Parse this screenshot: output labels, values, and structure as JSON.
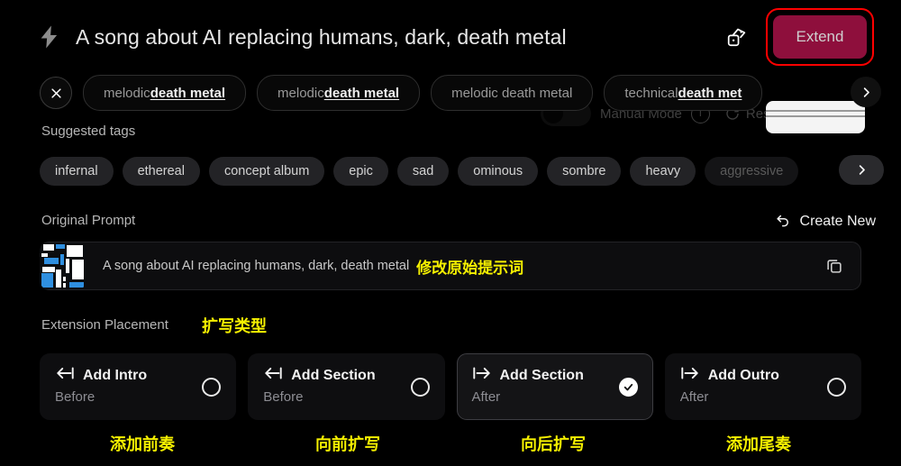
{
  "header": {
    "bolt_icon": "lightning-bolt-icon",
    "title": "A song about AI replacing humans, dark, death metal",
    "dice_icon": "dice-icon",
    "extend_label": "Extend",
    "extend_bg": "#8e0f3c",
    "highlight_color": "#ff0000"
  },
  "ghost_row": {
    "manual_mode_label": "Manual Mode",
    "info_icon": "info-icon",
    "refresh_icon": "refresh-icon",
    "reset_label": "Reset"
  },
  "style_chips": {
    "clear_icon": "close-icon",
    "next_icon": "chevron-right-icon",
    "items": [
      {
        "prefix": "melodic ",
        "emphasis": "death metal"
      },
      {
        "prefix": "melodic ",
        "emphasis": "death metal"
      },
      {
        "prefix": "melodic death metal",
        "emphasis": ""
      },
      {
        "prefix": "technical ",
        "emphasis": "death met"
      }
    ]
  },
  "suggested": {
    "label": "Suggested tags",
    "next_icon": "chevron-right-icon",
    "tags": [
      "infernal",
      "ethereal",
      "concept album",
      "epic",
      "sad",
      "ominous",
      "sombre",
      "heavy",
      "aggressive"
    ],
    "faded_tag": "aggressive"
  },
  "original_prompt": {
    "label": "Original Prompt",
    "create_new_label": "Create New",
    "undo_icon": "undo-arrow-icon",
    "thumbnail_icon": "cover-art-thumbnail",
    "value": "A song about AI replacing humans, dark, death metal",
    "annotation": "修改原始提示词",
    "copy_icon": "copy-icon"
  },
  "extension_placement": {
    "label": "Extension Placement",
    "annotation": "扩写类型",
    "annotation_color": "#f5f000",
    "options": [
      {
        "icon": "arrow-left-to-bar-icon",
        "title": "Add Intro",
        "sub": "Before",
        "selected": false,
        "note": "添加前奏"
      },
      {
        "icon": "arrow-left-to-bar-icon",
        "title": "Add Section",
        "sub": "Before",
        "selected": false,
        "note": "向前扩写"
      },
      {
        "icon": "bar-to-arrow-right-icon",
        "title": "Add Section",
        "sub": "After",
        "selected": true,
        "note": "向后扩写"
      },
      {
        "icon": "bar-to-arrow-right-icon",
        "title": "Add Outro",
        "sub": "After",
        "selected": false,
        "note": "添加尾奏"
      }
    ]
  }
}
